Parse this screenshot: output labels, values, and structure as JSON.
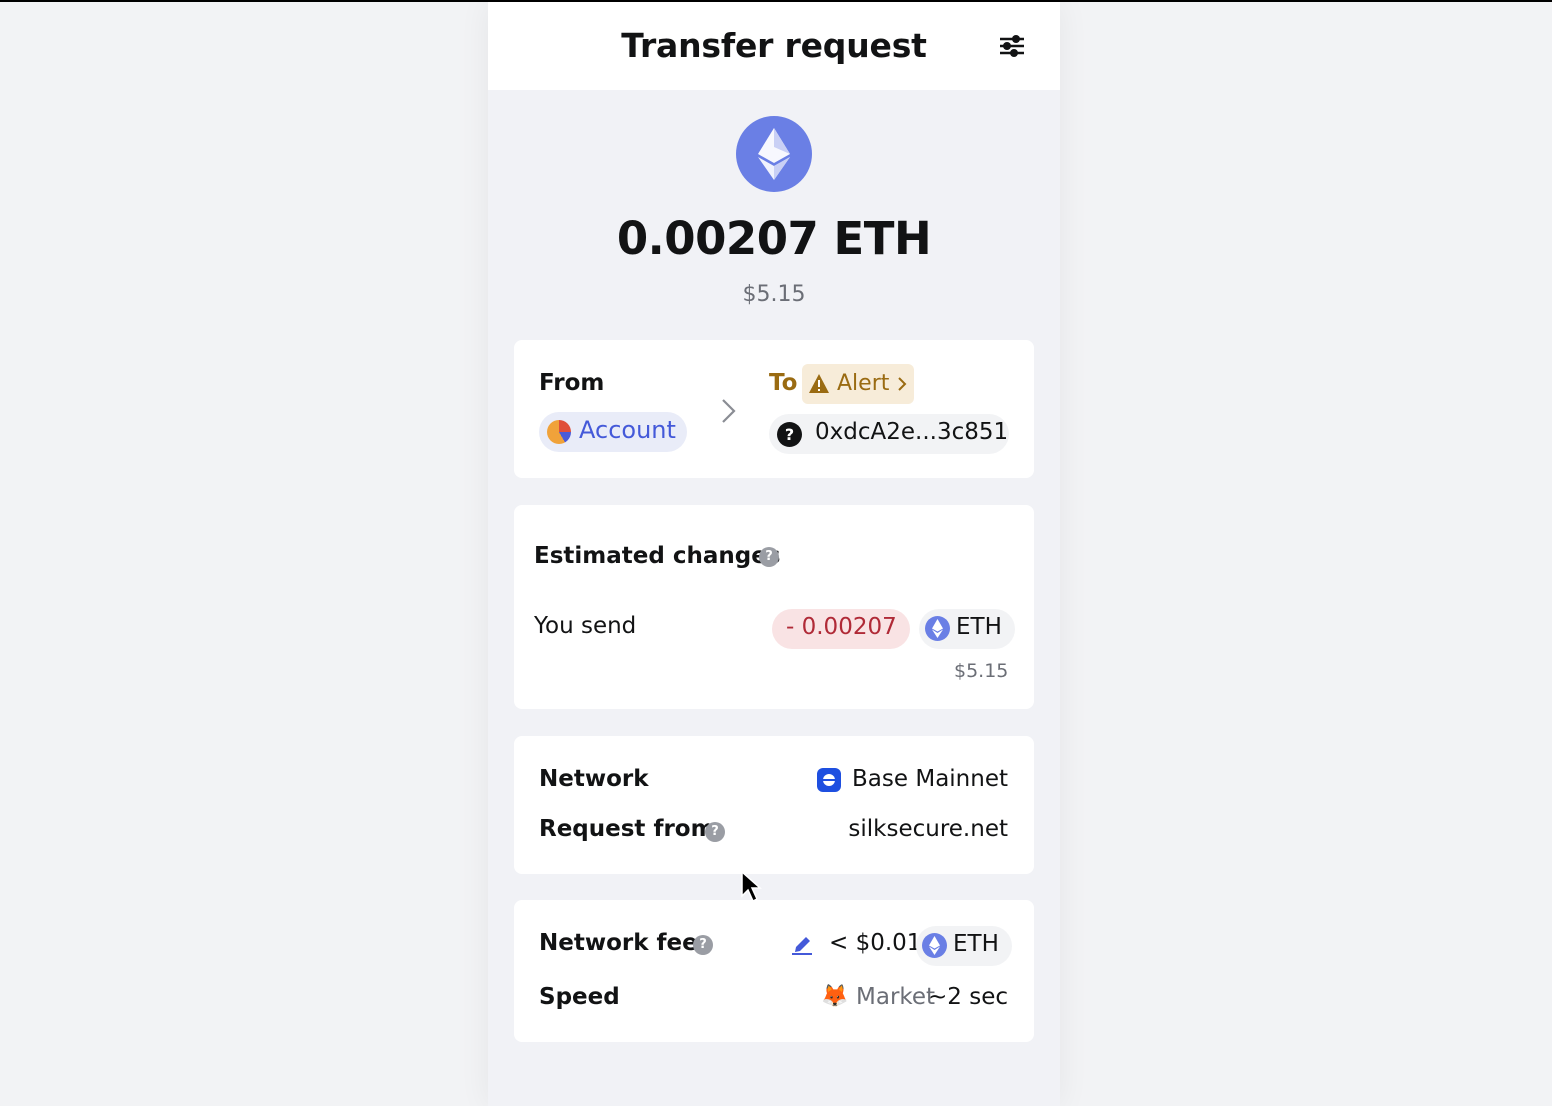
{
  "header": {
    "title": "Transfer request",
    "settings_icon": "sliders-icon"
  },
  "summary": {
    "token_icon": "ethereum-icon",
    "amount": "0.00207 ETH",
    "fiat": "$5.15"
  },
  "accounts": {
    "from_label": "From",
    "from_account": "Account",
    "to_label": "To",
    "alert_label": "Alert",
    "to_address": "0xdcA2e...3c851"
  },
  "estimated_changes": {
    "title": "Estimated changes",
    "you_send_label": "You send",
    "amount": "- 0.00207",
    "token": "ETH",
    "fiat": "$5.15"
  },
  "details": {
    "network_label": "Network",
    "network_value": "Base Mainnet",
    "request_from_label": "Request from",
    "request_from_value": "silksecure.net"
  },
  "fees": {
    "network_fee_label": "Network fee",
    "fee_value": "< $0.01",
    "fee_token": "ETH",
    "speed_label": "Speed",
    "speed_icon": "🦊",
    "speed_market": "Market",
    "speed_time": "~2 sec"
  },
  "colors": {
    "accent": "#4459d9",
    "eth": "#6a7fe5",
    "warning": "#9a6b12",
    "negative": "#b02a37"
  }
}
